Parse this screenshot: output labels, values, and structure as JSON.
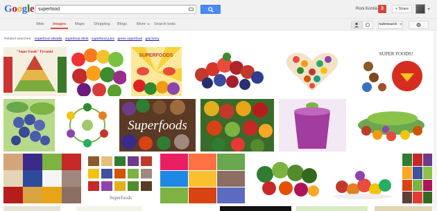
{
  "logo": {
    "letters": [
      "G",
      "o",
      "o",
      "g",
      "l",
      "e"
    ]
  },
  "search": {
    "value": "superfood"
  },
  "user": {
    "name": "Roni Kontiä",
    "notifications": "3"
  },
  "header": {
    "share_label": "+ Share"
  },
  "tabs": [
    {
      "label": "Web"
    },
    {
      "label": "Images"
    },
    {
      "label": "Maps"
    },
    {
      "label": "Shopping"
    },
    {
      "label": "Blogs"
    },
    {
      "label": "More"
    },
    {
      "label": "Search tools"
    }
  ],
  "toolbar": {
    "safesearch_label": "SafeSearch"
  },
  "related": {
    "label": "Related searches:",
    "items": [
      "superfood odwalla",
      "superfood drink",
      "superfood juice",
      "green superfood",
      "goji berry"
    ]
  },
  "thumb_text": {
    "pyramid": "\"Super Foods\" Pyramid",
    "superfoods_logo": "SUPERFOODS",
    "super_foods": "SUPER FOODS!",
    "superfoods_script": "Superfoods",
    "superfoods_small": "Superfoods"
  },
  "colors": {
    "accent": "#dd4b39",
    "link": "#1a0dab",
    "search_button": "#4a8af4"
  }
}
